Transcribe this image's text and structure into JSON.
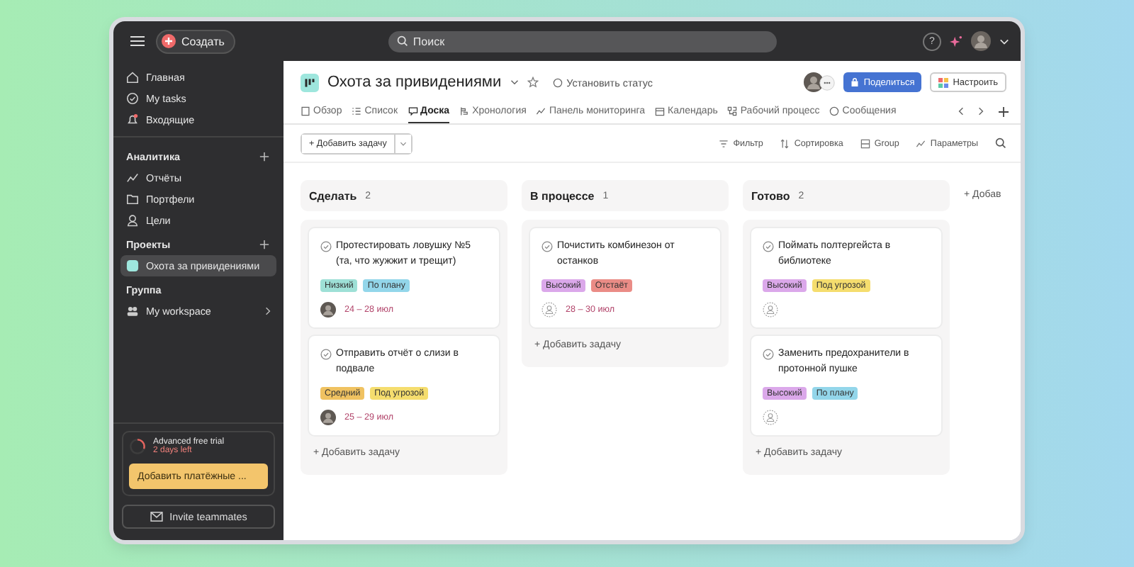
{
  "topbar": {
    "create_label": "Создать",
    "search_placeholder": "Поиск",
    "help_label": "?"
  },
  "sidebar": {
    "nav": [
      {
        "label": "Главная",
        "selected": false
      },
      {
        "label": "My tasks",
        "selected": false
      },
      {
        "label": "Входящие",
        "selected": false
      }
    ],
    "sections": [
      {
        "title": "Аналитика",
        "add": true,
        "items": [
          {
            "label": "Отчёты",
            "selected": false,
            "chevron": false
          },
          {
            "label": "Портфели",
            "selected": false,
            "chevron": false
          },
          {
            "label": "Цели",
            "selected": false,
            "chevron": false
          }
        ]
      },
      {
        "title": "Проекты",
        "add": true,
        "items": [
          {
            "label": "Охота за привидениями",
            "color": "#9ee6dd",
            "selected": true,
            "chevron": false
          }
        ]
      },
      {
        "title": "Группа",
        "add": false,
        "items": [
          {
            "label": "My workspace",
            "selected": false,
            "chevron": true
          }
        ]
      }
    ],
    "trial": {
      "title": "Advanced free trial",
      "subtitle": "2 days left",
      "level": 0.3,
      "button": "Добавить платёжные ..."
    },
    "invite": "Invite teammates"
  },
  "project": {
    "title": "Охота за привидениями",
    "status": "Установить статус",
    "share": "Поделиться",
    "customize": "Настроить"
  },
  "tabs": [
    {
      "label": "Обзор",
      "selected": false
    },
    {
      "label": "Список",
      "selected": false
    },
    {
      "label": "Доска",
      "selected": true
    },
    {
      "label": "Хронология",
      "selected": false
    },
    {
      "label": "Панель мониторинга",
      "selected": false
    },
    {
      "label": "Календарь",
      "selected": false
    },
    {
      "label": "Рабочий процесс",
      "selected": false
    },
    {
      "label": "Сообщения",
      "selected": false
    }
  ],
  "toolbar": {
    "add_task": "+ Добавить задачу",
    "actions": [
      "Фильтр",
      "Сортировка",
      "Group",
      "Параметры"
    ]
  },
  "columns": [
    {
      "title": "Сделать",
      "count": "2",
      "add_task": "+ Добавить задачу",
      "cards": [
        {
          "title": "Протестировать ловушку №5 (та, что жужжит и трещит)",
          "tags": [
            {
              "label": "Низкий",
              "color": "#9ee0d6"
            },
            {
              "label": "По плану",
              "color": "#93d6ea"
            }
          ],
          "assigned": true,
          "date": "24 – 28 июл"
        },
        {
          "title": "Отправить отчёт о слизи в подвале",
          "tags": [
            {
              "label": "Средний",
              "color": "#f0c261"
            },
            {
              "label": "Под угрозой",
              "color": "#f5dd6e"
            }
          ],
          "assigned": true,
          "date": "25 – 29 июл"
        }
      ]
    },
    {
      "title": "В процессе",
      "count": "1",
      "add_task": "+ Добавить задачу",
      "cards": [
        {
          "title": "Почистить комбинезон от останков",
          "tags": [
            {
              "label": "Высокий",
              "color": "#dba8ea"
            },
            {
              "label": "Отстаёт",
              "color": "#ea8c86"
            }
          ],
          "assigned": false,
          "date": "28 – 30 июл"
        }
      ]
    },
    {
      "title": "Готово",
      "count": "2",
      "add_task": "+ Добавить задачу",
      "cards": [
        {
          "title": "Поймать полтергейста в библиотеке",
          "tags": [
            {
              "label": "Высокий",
              "color": "#dba8ea"
            },
            {
              "label": "Под угрозой",
              "color": "#f5dd6e"
            }
          ],
          "assigned": false
        },
        {
          "title": "Заменить предохранители в протонной пушке",
          "tags": [
            {
              "label": "Высокий",
              "color": "#dba8ea"
            },
            {
              "label": "По плану",
              "color": "#93d6ea"
            }
          ],
          "assigned": false
        }
      ]
    }
  ],
  "add_section": "+ Добав"
}
